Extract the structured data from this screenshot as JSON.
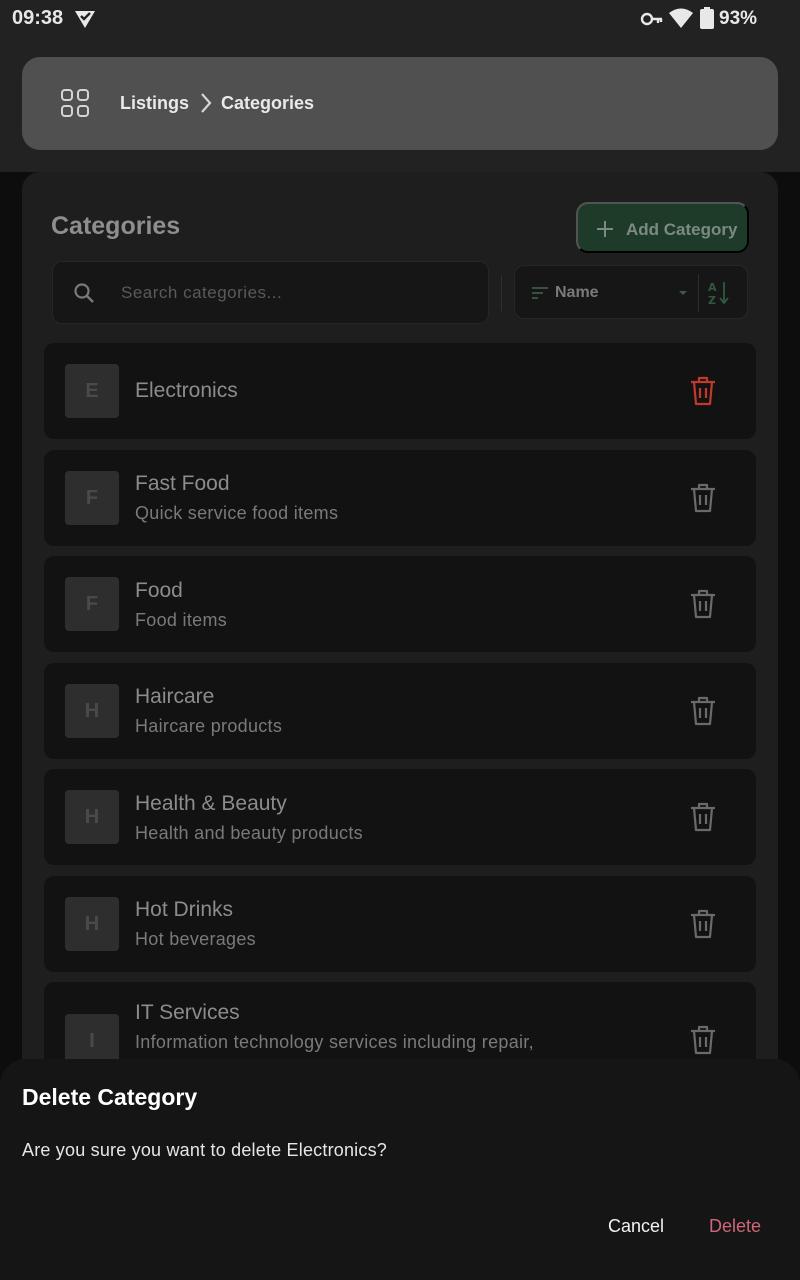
{
  "status_bar": {
    "time": "09:38",
    "battery": "93%",
    "icons": [
      "notification-check-icon",
      "vpn-key-icon",
      "wifi-icon",
      "battery-icon"
    ]
  },
  "breadcrumb": {
    "icon": "apps-grid-icon",
    "items": [
      "Listings",
      "Categories"
    ]
  },
  "header": {
    "title": "Categories",
    "add_button_label": "Add Category"
  },
  "search": {
    "placeholder": "Search categories...",
    "value": ""
  },
  "sort": {
    "selected": "Name",
    "direction_icon": "sort-az-icon"
  },
  "categories": [
    {
      "initial": "E",
      "name": "Electronics",
      "description": ""
    },
    {
      "initial": "F",
      "name": "Fast Food",
      "description": "Quick service food items"
    },
    {
      "initial": "F",
      "name": "Food",
      "description": "Food items"
    },
    {
      "initial": "H",
      "name": "Haircare",
      "description": "Haircare products"
    },
    {
      "initial": "H",
      "name": "Health & Beauty",
      "description": "Health and beauty products"
    },
    {
      "initial": "H",
      "name": "Hot Drinks",
      "description": "Hot beverages"
    },
    {
      "initial": "I",
      "name": "IT Services",
      "description": "Information technology services including repair,"
    }
  ],
  "dialog": {
    "title": "Delete Category",
    "message": "Are you sure you want to delete Electronics?",
    "cancel_label": "Cancel",
    "delete_label": "Delete"
  },
  "colors": {
    "accent_green": "#1d3b28",
    "danger_red": "#c0392b",
    "delete_text": "#d0667a"
  }
}
